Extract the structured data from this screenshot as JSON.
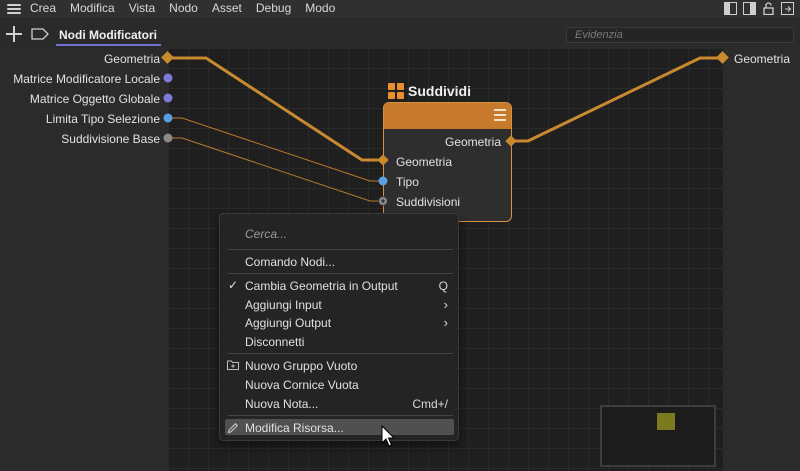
{
  "menubar": {
    "items": [
      "Crea",
      "Modifica",
      "Vista",
      "Nodo",
      "Asset",
      "Debug",
      "Modo"
    ]
  },
  "toolbar": {
    "tab_label": "Nodi Modificatori",
    "search_placeholder": "Evidenzia"
  },
  "inputs": {
    "ports": [
      "Geometria",
      "Matrice Modificatore Locale",
      "Matrice Oggetto Globale",
      "Limita Tipo Selezione",
      "Suddivisione Base"
    ]
  },
  "outputs": {
    "ports": [
      "Geometria"
    ]
  },
  "node": {
    "title": "Suddividi",
    "output_port": "Geometria",
    "input_ports": [
      "Geometria",
      "Tipo",
      "Suddivisioni"
    ],
    "header_color": "#c77a2c"
  },
  "context_menu": {
    "search_placeholder": "Cerca...",
    "items": [
      {
        "label": "Comando Nodi..."
      },
      {
        "label": "Cambia Geometria in Output",
        "checked": true,
        "shortcut": "Q"
      },
      {
        "label": "Aggiungi Input",
        "submenu": true
      },
      {
        "label": "Aggiungi Output",
        "submenu": true
      },
      {
        "label": "Disconnetti"
      },
      {
        "label": "Nuovo Gruppo Vuoto",
        "icon": "folder-plus-icon"
      },
      {
        "label": "Nuova Cornice Vuota"
      },
      {
        "label": "Nuova Nota...",
        "shortcut": "Cmd+/"
      },
      {
        "label": "Modifica Risorsa...",
        "icon": "pencil-icon",
        "highlighted": true
      }
    ]
  },
  "colors": {
    "geometry_wire": "#d08a2e",
    "matrix_port": "#7b7bd8",
    "type_port": "#5aa0e0",
    "int_port": "#8a8a8a",
    "tab_underline": "#6f6fd6"
  }
}
